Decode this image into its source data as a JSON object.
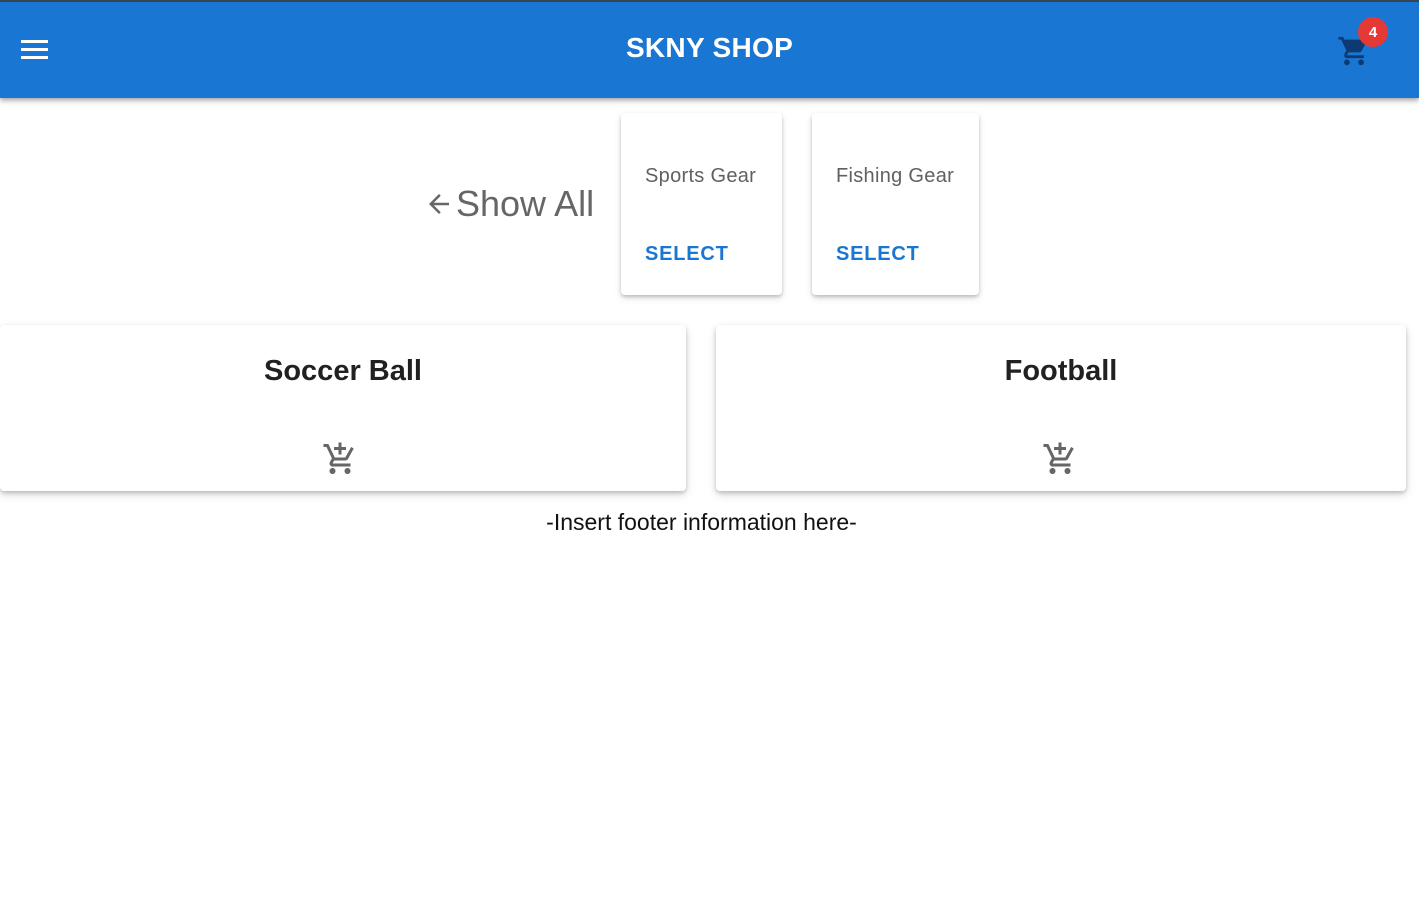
{
  "appbar": {
    "title": "SKNY SHOP",
    "menu_icon": "menu-icon",
    "cart_icon": "shopping-cart-icon",
    "cart_count": "4",
    "color": "#1976d2",
    "badge_color": "#e53935"
  },
  "navigation": {
    "show_all_label": "Show All",
    "show_all_icon": "arrow-left-icon"
  },
  "categories": [
    {
      "name": "Sports Gear",
      "action": "SELECT"
    },
    {
      "name": "Fishing Gear",
      "action": "SELECT"
    }
  ],
  "products": [
    {
      "name": "Soccer Ball",
      "action_icon": "add-to-cart-icon"
    },
    {
      "name": "Football",
      "action_icon": "add-to-cart-icon"
    }
  ],
  "footer": {
    "text": "-Insert footer information here-"
  }
}
